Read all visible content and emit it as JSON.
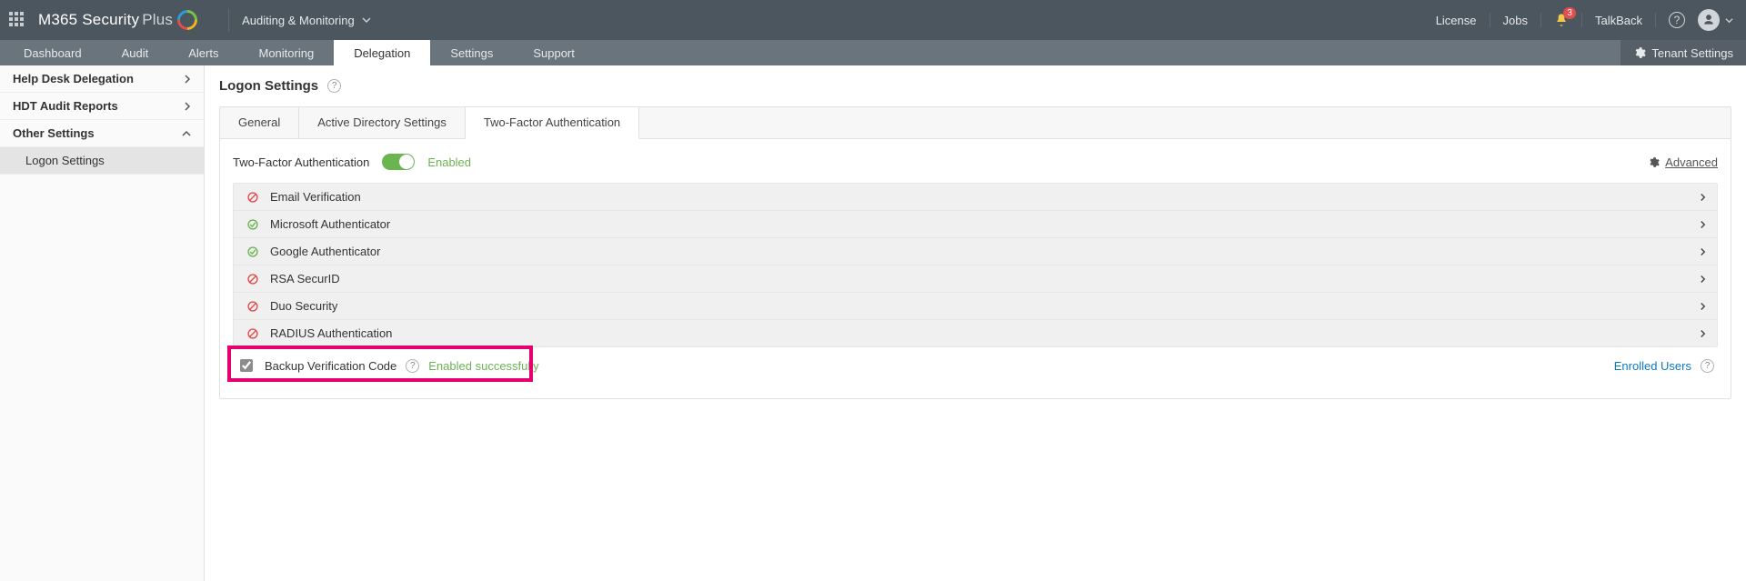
{
  "topbar": {
    "brand_main": "M365 Security",
    "brand_suffix": "Plus",
    "workspace": "Auditing & Monitoring",
    "links": {
      "license": "License",
      "jobs": "Jobs",
      "talkback": "TalkBack"
    },
    "notification_count": "3"
  },
  "nav": {
    "tabs": [
      "Dashboard",
      "Audit",
      "Alerts",
      "Monitoring",
      "Delegation",
      "Settings",
      "Support"
    ],
    "active": "Delegation",
    "tenant_button": "Tenant Settings"
  },
  "sidebar": {
    "items": [
      {
        "label": "Help Desk Delegation",
        "expandable": true,
        "expanded": false
      },
      {
        "label": "HDT Audit Reports",
        "expandable": true,
        "expanded": false
      },
      {
        "label": "Other Settings",
        "expandable": true,
        "expanded": true,
        "children": [
          {
            "label": "Logon Settings",
            "selected": true
          }
        ]
      }
    ]
  },
  "page": {
    "title": "Logon Settings",
    "content_tabs": [
      "General",
      "Active Directory Settings",
      "Two-Factor Authentication"
    ],
    "active_content_tab": "Two-Factor Authentication"
  },
  "tfa": {
    "heading": "Two-Factor Authentication",
    "toggle_on": true,
    "enabled_label": "Enabled",
    "advanced_label": "Advanced",
    "methods": [
      {
        "name": "Email Verification",
        "state": "disabled"
      },
      {
        "name": "Microsoft Authenticator",
        "state": "enabled"
      },
      {
        "name": "Google Authenticator",
        "state": "enabled"
      },
      {
        "name": "RSA SecurID",
        "state": "disabled"
      },
      {
        "name": "Duo Security",
        "state": "disabled"
      },
      {
        "name": "RADIUS Authentication",
        "state": "disabled"
      }
    ],
    "backup": {
      "checked": true,
      "label": "Backup Verification Code",
      "status": "Enabled successfully",
      "enrolled_link": "Enrolled Users"
    }
  }
}
